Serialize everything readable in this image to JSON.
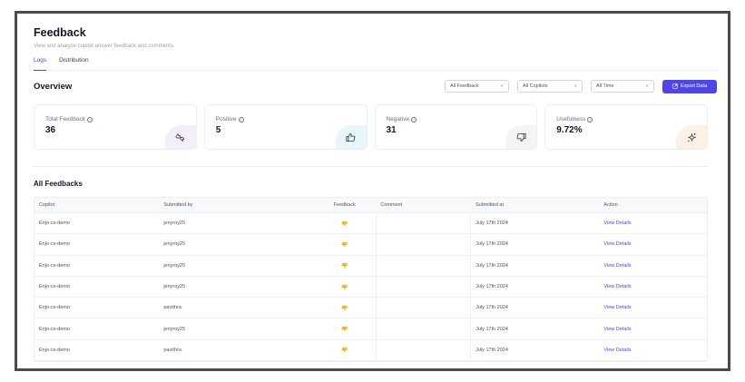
{
  "header": {
    "title": "Feedback",
    "subtitle": "View and analyze copilot answer feedback and comments."
  },
  "tabs": [
    {
      "label": "Logs",
      "active": true
    },
    {
      "label": "Distribution",
      "active": false
    }
  ],
  "overview": {
    "title": "Overview",
    "filters": {
      "feedback": "All Feedback",
      "copilots": "All Copilots",
      "time": "All Time"
    },
    "export_label": "Export Data"
  },
  "stats": [
    {
      "label": "Total Feedback",
      "value": "36",
      "icon": "thumbs-up-down-icon"
    },
    {
      "label": "Positive",
      "value": "5",
      "icon": "thumbs-up-icon"
    },
    {
      "label": "Negative",
      "value": "31",
      "icon": "thumbs-down-icon"
    },
    {
      "label": "Usefulness",
      "value": "9.72%",
      "icon": "sparkles-icon"
    }
  ],
  "table": {
    "title": "All Feedbacks",
    "columns": [
      "Copilot",
      "Submitted by",
      "Feedback",
      "Comment",
      "Submitted at",
      "Action"
    ],
    "rows": [
      {
        "copilot": "Enjo-cs-demo",
        "submitted_by": "jenyroy25",
        "feedback": "thumbs-down",
        "comment": "",
        "submitted_at": "July 17th 2024",
        "action": "View Details"
      },
      {
        "copilot": "Enjo-cs-demo",
        "submitted_by": "jenyroy25",
        "feedback": "thumbs-down",
        "comment": "",
        "submitted_at": "July 17th 2024",
        "action": "View Details"
      },
      {
        "copilot": "Enjo-cs-demo",
        "submitted_by": "jenyroy25",
        "feedback": "thumbs-down",
        "comment": "",
        "submitted_at": "July 17th 2024",
        "action": "View Details"
      },
      {
        "copilot": "Enjo-cs-demo",
        "submitted_by": "jenyroy25",
        "feedback": "thumbs-down",
        "comment": "",
        "submitted_at": "July 17th 2024",
        "action": "View Details"
      },
      {
        "copilot": "Enjo-cs-demo",
        "submitted_by": "pavithra",
        "feedback": "thumbs-down",
        "comment": "",
        "submitted_at": "July 17th 2024",
        "action": "View Details"
      },
      {
        "copilot": "Enjo-cs-demo",
        "submitted_by": "jenyroy25",
        "feedback": "thumbs-down",
        "comment": "",
        "submitted_at": "July 17th 2024",
        "action": "View Details"
      },
      {
        "copilot": "Enjo-cs-demo",
        "submitted_by": "pavithra",
        "feedback": "thumbs-down",
        "comment": "",
        "submitted_at": "July 17th 2024",
        "action": "View Details"
      }
    ]
  },
  "colors": {
    "accent": "#4f46e5",
    "feedback_icon": "#f5b316"
  }
}
